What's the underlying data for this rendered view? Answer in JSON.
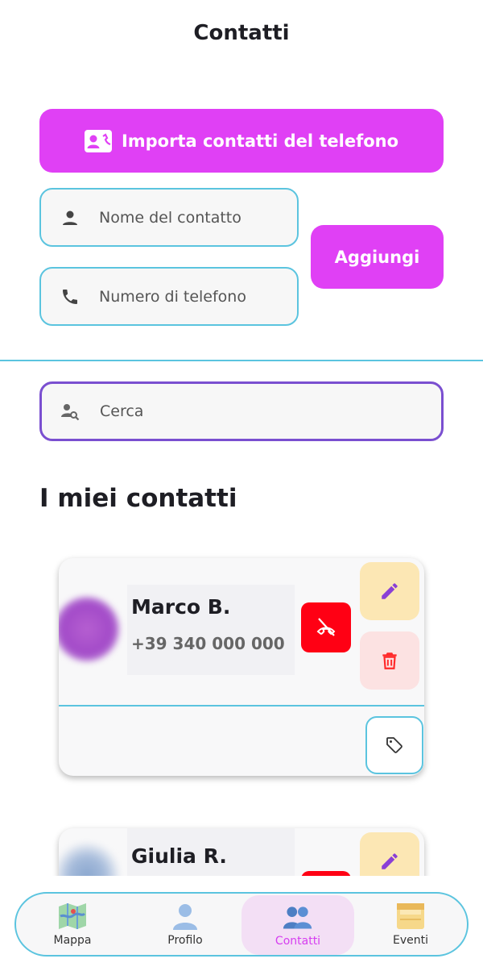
{
  "header": {
    "title": "Contatti"
  },
  "import_button": {
    "label": "Importa contatti del telefono",
    "icon": "contact-card-icon"
  },
  "form": {
    "name_placeholder": "Nome del contatto",
    "phone_placeholder": "Numero di telefono",
    "add_label": "Aggiungi"
  },
  "search": {
    "placeholder": "Cerca"
  },
  "section": {
    "title": "I miei contatti"
  },
  "contacts": [
    {
      "name": "Marco B.",
      "phone": "+39 340 000 000"
    },
    {
      "name": "Giulia R.",
      "phone": ""
    }
  ],
  "nav": {
    "items": [
      {
        "label": "Mappa",
        "icon": "map-icon"
      },
      {
        "label": "Profilo",
        "icon": "profile-icon"
      },
      {
        "label": "Contatti",
        "icon": "contacts-icon",
        "active": true
      },
      {
        "label": "Eventi",
        "icon": "events-icon"
      }
    ]
  },
  "colors": {
    "accent": "#e040f5",
    "field_border": "#5bc4df",
    "search_border": "#7a4fd0",
    "danger": "#ff0014"
  }
}
